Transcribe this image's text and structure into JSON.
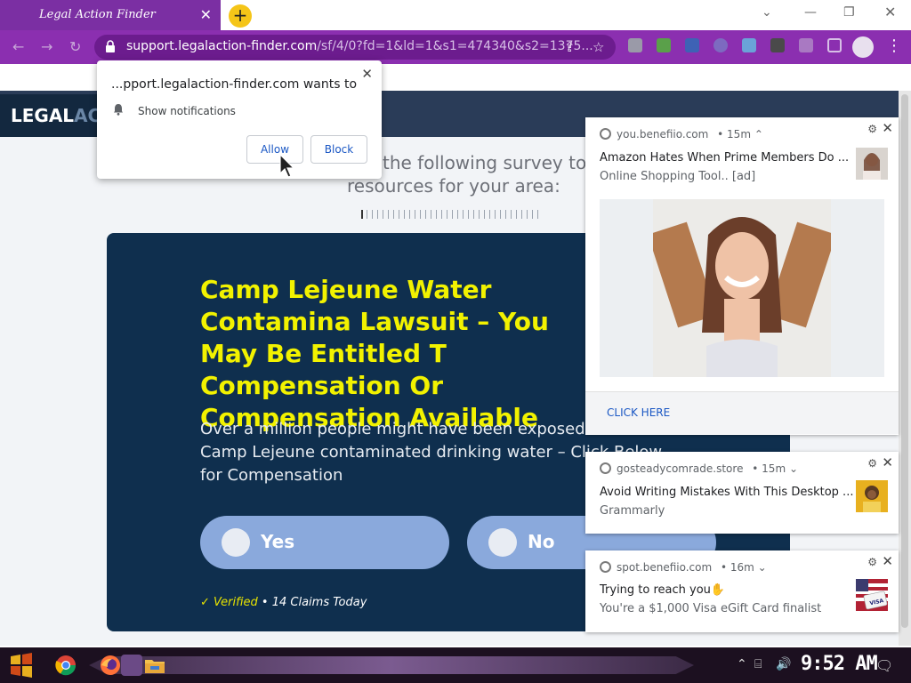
{
  "browser": {
    "tab_title": "Legal Action Finder",
    "tab_close": "✕",
    "new_tab": "+",
    "url_host": "support.legalaction-finder.com",
    "url_path": "/sf/4/0?fd=1&ld=1&s1=474340&s2=1375...",
    "window_controls": [
      "⌄",
      "—",
      "❐",
      "✕"
    ]
  },
  "permission_popup": {
    "title": "...pport.legalaction-finder.com wants to",
    "item": "Show notifications",
    "allow_label": "Allow",
    "block_label": "Block",
    "close": "✕"
  },
  "page": {
    "logo_text": "LEGAL",
    "logo_fade": "AC",
    "survey_line1": "the following survey to s",
    "survey_line2": "resources for your area:",
    "card": {
      "title": "Camp Lejeune Water Contamina Lawsuit – You May Be Entitled T Compensation Or Compensation Available",
      "description": "Over a million people might have been exposed to the Camp Lejeune contaminated drinking water – Click Below for Compensation",
      "yes_label": "Yes",
      "no_label": "No",
      "verified_check": "✓",
      "verified_word": "Verified",
      "verified_rest": " • 14 Claims Today"
    }
  },
  "notifications": [
    {
      "source": "you.benefiio.com",
      "time": "• 15m ⌃",
      "title": "Amazon Hates When Prime Members Do ...",
      "subtitle": "Online Shopping Tool.. [ad]",
      "cta": "CLICK HERE"
    },
    {
      "source": "gosteadycomrade.store",
      "time": "• 15m ⌄",
      "title": "Avoid Writing Mistakes With This Desktop ...",
      "subtitle": "Grammarly"
    },
    {
      "source": "spot.benefiio.com",
      "time": "• 16m ⌄",
      "title": "Trying to reach you✋",
      "subtitle": "You're a $1,000 Visa eGift Card finalist"
    }
  ],
  "taskbar": {
    "clock": "9:52 AM"
  },
  "colors": {
    "browser_purple": "#8b2fb0",
    "card_navy": "#0f2f4e",
    "headline_yellow": "#f2f200",
    "choice_blue": "#8aa9dc",
    "link_blue": "#1a57c4"
  }
}
